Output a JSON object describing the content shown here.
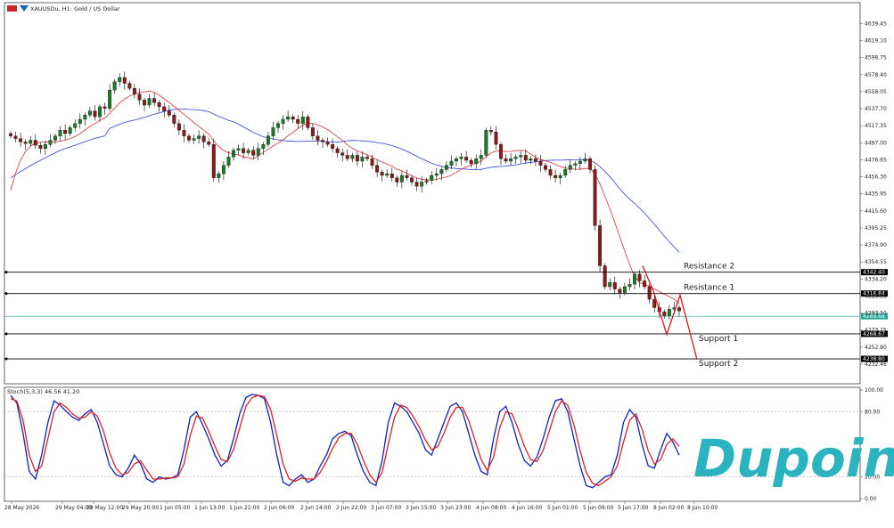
{
  "header": {
    "title": "XAUUSDu, H1: Gold / US Dollar"
  },
  "logo": {
    "text": "Dupoin"
  },
  "colors": {
    "bull": "#1a7a2a",
    "bear": "#8a1a1a",
    "ma_fast": "#e03030",
    "ma_slow": "#2d3fd8",
    "stoch_main": "#1020c0",
    "stoch_signal": "#e02020",
    "current_price": "#26a69a"
  },
  "chart_data": [
    {
      "type": "candlestick",
      "title": "XAUUSDu, H1: Gold / US Dollar",
      "ylim": [
        4232.46,
        4649.45
      ],
      "yticks": [
        "4639.45",
        "4619.10",
        "4598.75",
        "4578.40",
        "4558.05",
        "4537.70",
        "4517.35",
        "4497.00",
        "4476.65",
        "4456.30",
        "4435.95",
        "4415.60",
        "4395.25",
        "4374.90",
        "4354.55",
        "4334.20",
        "4313.85",
        "4293.50",
        "4273.15",
        "4252.80",
        "4232.46"
      ],
      "xticks": [
        "28 May 2026",
        "29 May 04:00",
        "29 May 12:00",
        "29 May 20:00",
        "1 Jun 05:00",
        "1 Jun 13:00",
        "1 Jun 21:00",
        "2 Jun 06:00",
        "2 Jun 14:00",
        "2 Jun 22:00",
        "3 Jun 07:00",
        "3 Jun 15:00",
        "3 Jun 23:00",
        "4 Jun 08:00",
        "4 Jun 16:00",
        "5 Jun 01:00",
        "5 Jun 09:00",
        "5 Jun 17:00",
        "8 Jun 02:00",
        "8 Jun 10:00"
      ],
      "close_path": [
        4505,
        4502,
        4498,
        4496,
        4500,
        4494,
        4490,
        4495,
        4500,
        4505,
        4512,
        4508,
        4515,
        4520,
        4525,
        4530,
        4535,
        4528,
        4540,
        4538,
        4560,
        4570,
        4575,
        4568,
        4562,
        4555,
        4548,
        4542,
        4550,
        4545,
        4540,
        4535,
        4530,
        4520,
        4512,
        4505,
        4500,
        4502,
        4505,
        4498,
        4495,
        4455,
        4460,
        4470,
        4480,
        4488,
        4490,
        4485,
        4488,
        4482,
        4490,
        4495,
        4505,
        4515,
        4520,
        4525,
        4528,
        4525,
        4520,
        4528,
        4515,
        4505,
        4500,
        4498,
        4495,
        4490,
        4485,
        4482,
        4478,
        4482,
        4475,
        4480,
        4478,
        4470,
        4462,
        4458,
        4460,
        4455,
        4450,
        4458,
        4455,
        4450,
        4445,
        4450,
        4452,
        4458,
        4460,
        4465,
        4470,
        4475,
        4478,
        4480,
        4476,
        4472,
        4478,
        4482,
        4512,
        4510,
        4495,
        4478,
        4475,
        4478,
        4480,
        4482,
        4476,
        4478,
        4475,
        4470,
        4465,
        4458,
        4455,
        4458,
        4465,
        4470,
        4472,
        4475,
        4478,
        4465,
        4398,
        4350,
        4325,
        4330,
        4322,
        4318,
        4325,
        4328,
        4340,
        4332,
        4325,
        4310,
        4300,
        4295,
        4290,
        4298,
        4300,
        4296
      ],
      "levels": [
        {
          "label": "Resistance 2",
          "value": 4342.4,
          "tag": "4342.40"
        },
        {
          "label": "Resistance 1",
          "value": 4316.84,
          "tag": "4316.84"
        },
        {
          "label": "",
          "value": 4289.68,
          "tag": "4289.68"
        },
        {
          "label": "Support 1",
          "value": 4268.67,
          "tag": "4268.67"
        },
        {
          "label": "Support 2",
          "value": 4238.8,
          "tag": "4238.80"
        }
      ],
      "projection": [
        4350,
        4320,
        4268,
        4315,
        4238
      ]
    },
    {
      "type": "line",
      "title": "Stoch(5,3,3) 46.56 41.20",
      "ylim": [
        0,
        100
      ],
      "yticks": [
        "100.00",
        "80.00",
        "20.00",
        "0.00"
      ],
      "levels": [
        80,
        20
      ],
      "series": [
        {
          "name": "Stoch(5,3,3)",
          "values": [
            95,
            88,
            60,
            25,
            18,
            40,
            70,
            90,
            86,
            80,
            75,
            72,
            78,
            82,
            70,
            50,
            30,
            22,
            20,
            28,
            40,
            32,
            18,
            15,
            20,
            18,
            19,
            22,
            45,
            75,
            80,
            68,
            55,
            40,
            30,
            35,
            55,
            78,
            93,
            96,
            95,
            92,
            70,
            40,
            15,
            12,
            18,
            22,
            15,
            18,
            30,
            40,
            55,
            60,
            62,
            58,
            40,
            25,
            15,
            12,
            35,
            70,
            88,
            85,
            80,
            70,
            60,
            45,
            40,
            55,
            70,
            85,
            88,
            80,
            60,
            40,
            25,
            22,
            55,
            80,
            85,
            70,
            50,
            35,
            30,
            38,
            55,
            75,
            90,
            92,
            80,
            55,
            30,
            12,
            10,
            15,
            20,
            22,
            40,
            70,
            82,
            75,
            50,
            30,
            28,
            45,
            60,
            52,
            40
          ]
        },
        {
          "name": "",
          "values": [
            92,
            90,
            72,
            40,
            25,
            30,
            55,
            80,
            88,
            84,
            78,
            74,
            75,
            80,
            76,
            62,
            42,
            28,
            22,
            24,
            32,
            35,
            26,
            18,
            18,
            19,
            19,
            20,
            32,
            58,
            76,
            74,
            62,
            48,
            36,
            34,
            45,
            65,
            85,
            93,
            95,
            94,
            82,
            58,
            32,
            18,
            16,
            19,
            18,
            18,
            24,
            34,
            46,
            56,
            60,
            60,
            50,
            35,
            22,
            15,
            24,
            50,
            75,
            86,
            84,
            76,
            66,
            54,
            45,
            48,
            60,
            75,
            84,
            84,
            72,
            54,
            36,
            26,
            38,
            65,
            80,
            78,
            64,
            48,
            36,
            34,
            44,
            62,
            80,
            90,
            86,
            68,
            44,
            24,
            14,
            12,
            16,
            20,
            30,
            52,
            72,
            78,
            64,
            44,
            32,
            36,
            50,
            55,
            48
          ]
        }
      ]
    }
  ]
}
